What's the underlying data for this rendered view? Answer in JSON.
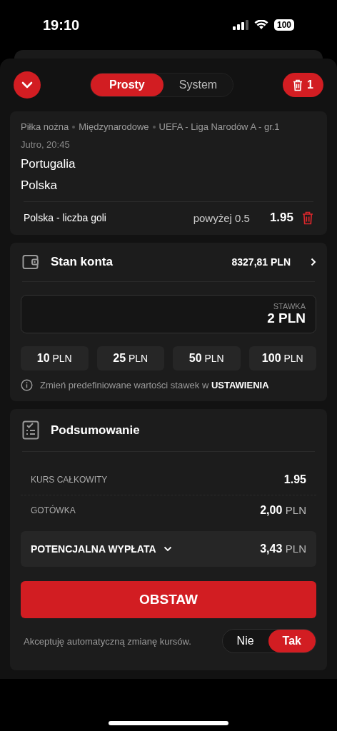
{
  "status_bar": {
    "time": "19:10",
    "battery": "100"
  },
  "header": {
    "tabs": [
      {
        "label": "Prosty",
        "selected": true
      },
      {
        "label": "System",
        "selected": false
      }
    ],
    "trash_count": "1"
  },
  "event": {
    "breadcrumb": [
      "Piłka nożna",
      "Międzynarodowe",
      "UEFA - Liga Narodów A - gr.1"
    ],
    "time": "Jutro, 20:45",
    "teams": [
      "Portugalia",
      "Polska"
    ],
    "selection": {
      "market": "Polska - liczba goli",
      "pick": "powyżej 0.5",
      "odds": "1.95"
    }
  },
  "account": {
    "title": "Stan konta",
    "balance": "8327,81 PLN",
    "stake_label": "STAWKA",
    "stake_value": "2 PLN",
    "quick_stakes": [
      {
        "amount": "10",
        "currency": "PLN"
      },
      {
        "amount": "25",
        "currency": "PLN"
      },
      {
        "amount": "50",
        "currency": "PLN"
      },
      {
        "amount": "100",
        "currency": "PLN"
      }
    ],
    "info": "Zmień predefiniowane wartości stawek w **USTAWIENIA**"
  },
  "summary": {
    "title": "Podsumowanie",
    "rows": [
      {
        "label": "KURS CAŁKOWITY",
        "value": "1.95"
      },
      {
        "label": "GOTÓWKA",
        "value": "2,00",
        "currency": "PLN"
      }
    ],
    "payout": {
      "label": "POTENCJALNA WYPŁATA",
      "value": "3,43",
      "currency": "PLN"
    },
    "submit": "OBSTAW",
    "accept_label": "Akceptuję automatyczną zmianę kursów.",
    "accept_options": [
      {
        "label": "Nie",
        "selected": false
      },
      {
        "label": "Tak",
        "selected": true
      }
    ]
  }
}
